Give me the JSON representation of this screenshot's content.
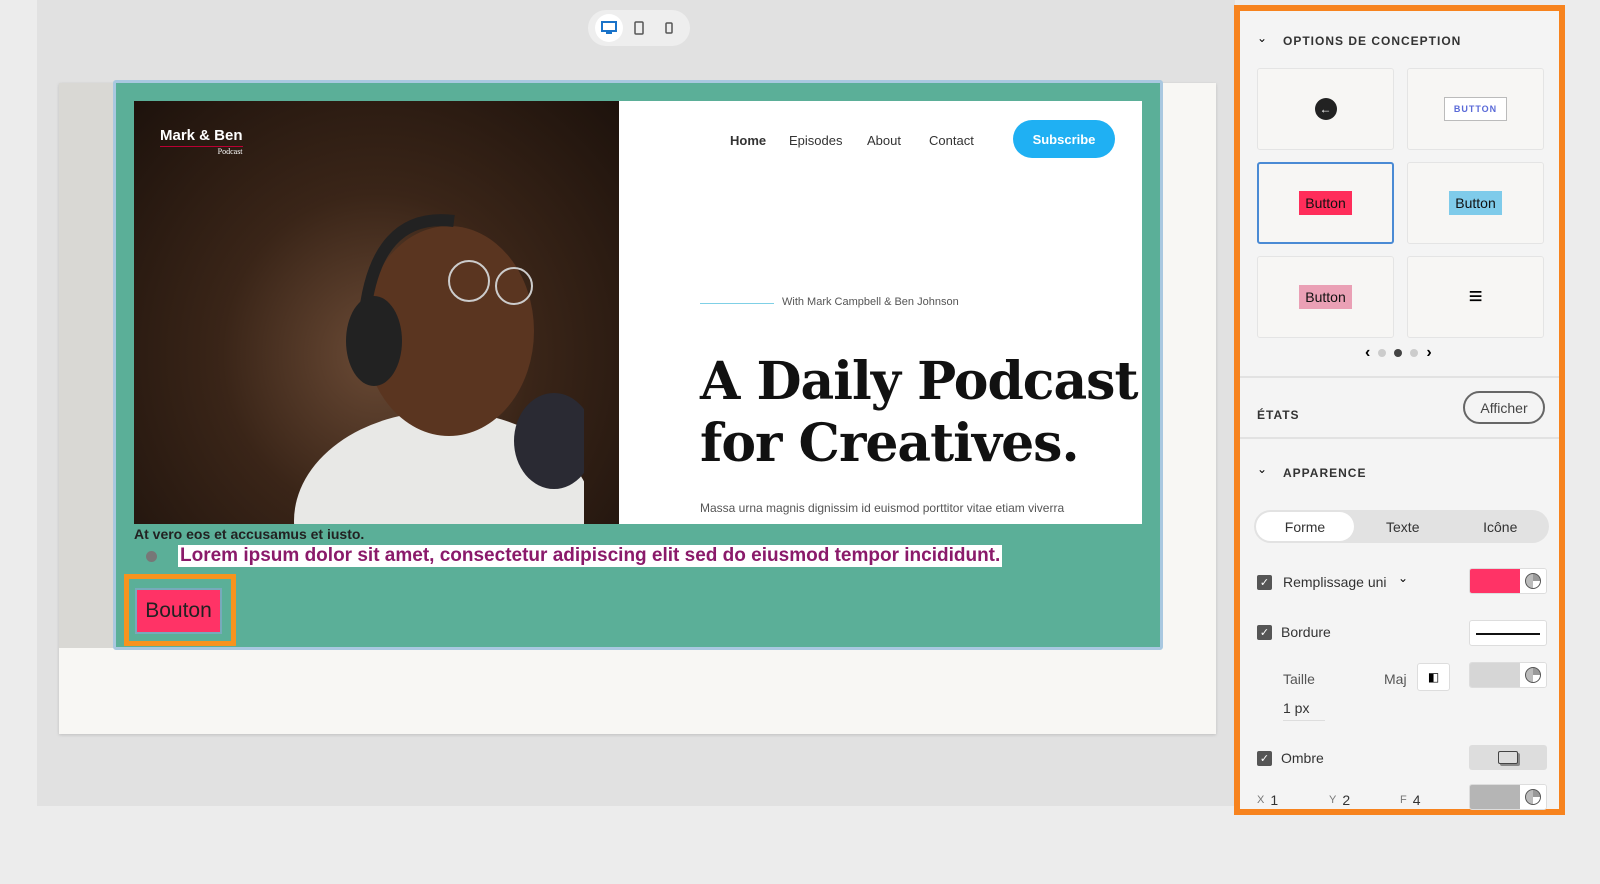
{
  "toolbar": {
    "devices": [
      "desktop",
      "tablet",
      "mobile"
    ],
    "active": "desktop"
  },
  "site": {
    "logo": "Mark & Ben",
    "logo_sub": "Podcast",
    "nav": [
      "Home",
      "Episodes",
      "About",
      "Contact"
    ],
    "subscribe": "Subscribe",
    "with": "With Mark Campbell & Ben Johnson",
    "title_1": "A Daily Podcast",
    "title_2": "for Creatives.",
    "massa": "Massa urna magnis dignissim id euismod porttitor vitae etiam viverra",
    "atvero": "At vero eos et accusamus et iusto.",
    "lorem": "Lorem ipsum dolor sit amet, consectetur adipiscing elit sed do eiusmod tempor incididunt.",
    "bouton": "Bouton"
  },
  "panel": {
    "design_title": "OPTIONS DE CONCEPTION",
    "presets": [
      "←",
      "BUTTON",
      "Button",
      "Button",
      "Button",
      "≡"
    ],
    "pager": {
      "pages": 3,
      "current": 2
    },
    "states_title": "ÉTATS",
    "states_button": "Afficher",
    "appearance_title": "APPARENCE",
    "tabs": [
      "Forme",
      "Texte",
      "Icône"
    ],
    "active_tab": "Forme",
    "fill_label": "Remplissage uni",
    "fill_color": "#ff3366",
    "border_label": "Bordure",
    "size_label": "Taille",
    "maj_label": "Maj",
    "size_value": "1 px",
    "shadow_label": "Ombre",
    "shadow": {
      "x_label": "X",
      "x": "1",
      "y_label": "Y",
      "y": "2",
      "f_label": "F",
      "f": "4"
    }
  }
}
